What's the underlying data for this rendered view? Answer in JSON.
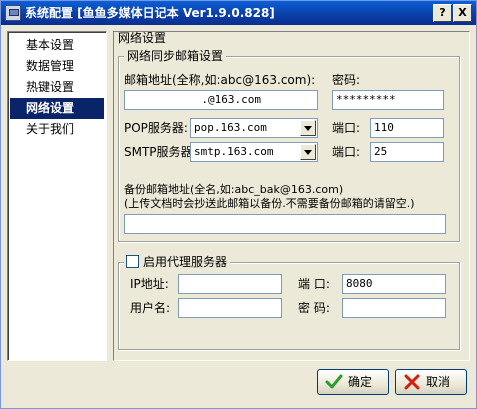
{
  "window": {
    "title": "系统配置 [鱼鱼多媒体日记本 Ver1.9.0.828]",
    "help_label": "?",
    "close_label": "X"
  },
  "nav": {
    "items": [
      {
        "label": "基本设置",
        "selected": false
      },
      {
        "label": "数据管理",
        "selected": false
      },
      {
        "label": "热键设置",
        "selected": false
      },
      {
        "label": "网络设置",
        "selected": true
      },
      {
        "label": "关于我们",
        "selected": false
      }
    ]
  },
  "panel": {
    "title": "网络设置",
    "mail_group": {
      "legend": "网络同步邮箱设置",
      "email_label": "邮箱地址(全称,如:abc@163.com):",
      "email_value": ".@163.com",
      "password_label": "密码:",
      "password_value": "*********",
      "pop_label": "POP服务器:",
      "pop_value": "pop.163.com",
      "pop_port_label": "端口:",
      "pop_port_value": "110",
      "smtp_label": "SMTP服务器:",
      "smtp_value": "smtp.163.com",
      "smtp_port_label": "端口:",
      "smtp_port_value": "25",
      "backup_label": "备份邮箱地址(全名,如:abc_bak@163.com)",
      "backup_hint": "(上传文档时会抄送此邮箱以备份.不需要备份邮箱的请留空.)",
      "backup_value": ""
    },
    "proxy_group": {
      "checkbox_label": "启用代理服务器",
      "checked": false,
      "ip_label": "IP地址:",
      "ip_value": "",
      "port_label": "端    口:",
      "port_value": "8080",
      "user_label": "用户名:",
      "user_value": "",
      "pass_label": "密    码:",
      "pass_value": ""
    }
  },
  "buttons": {
    "ok_label": "确定",
    "cancel_label": "取消"
  },
  "colors": {
    "title_bar": "#0a3fa8",
    "selection": "#0a246a",
    "face": "#ece9d8",
    "ok_icon": "#2e9e2e",
    "cancel_icon": "#d02010"
  }
}
